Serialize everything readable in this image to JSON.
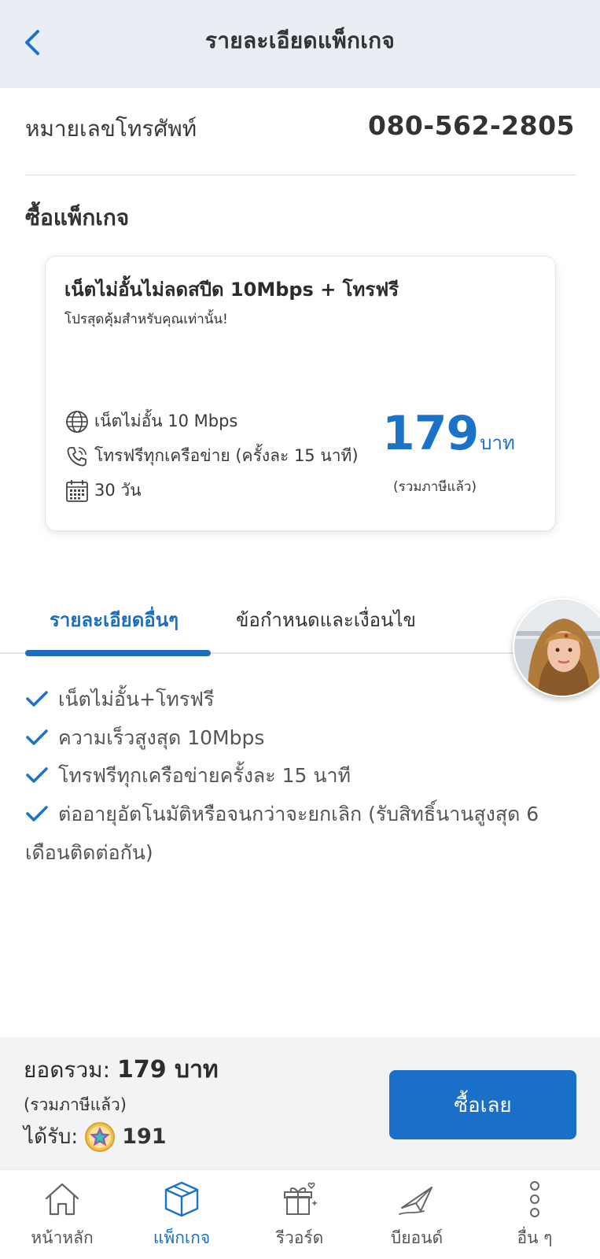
{
  "header": {
    "title": "รายละเอียดแพ็กเกจ",
    "back_icon": "chevron-left-icon"
  },
  "phone": {
    "label": "หมายเลขโทรศัพท์",
    "value": "080-562-2805"
  },
  "section_title": "ซื้อแพ็กเกจ",
  "package": {
    "name": "เน็ตไม่อั้นไม่ลดสปีด 10Mbps + โทรฟรี",
    "subtitle": "โปรสุดคุ้มสำหรับคุณเท่านั้น!",
    "features": [
      {
        "icon": "globe-icon",
        "text": "เน็ตไม่อั้น 10 Mbps"
      },
      {
        "icon": "phone-call-icon",
        "text": "โทรฟรีทุกเครือข่าย (ครั้งละ 15 นาที)"
      },
      {
        "icon": "calendar-icon",
        "text": "30 วัน"
      }
    ],
    "price": "179",
    "price_unit": "บาท",
    "price_note": "(รวมภาษีแล้ว)",
    "accent_color": "#1a73c9"
  },
  "tabs": [
    {
      "label": "รายละเอียดอื่นๆ",
      "active": true
    },
    {
      "label": "ข้อกำหนดและเงื่อนไข",
      "active": false
    }
  ],
  "details": [
    "เน็ตไม่อั้น+โทรฟรี",
    "ความเร็วสูงสุด 10Mbps",
    "โทรฟรีทุกเครือข่ายครั้งละ 15 นาที",
    "ต่ออายุอัตโนมัติหรือจนกว่าจะยกเลิก (รับสิทธิ์นานสูงสุด 6 เดือนติดต่อกัน)"
  ],
  "summary": {
    "total_label": "ยอดรวม:",
    "total_value": "179 บาท",
    "total_note": "(รวมภาษีแล้ว)",
    "points_label": "ได้รับ:",
    "points_value": "191",
    "buy_label": "ซื้อเลย"
  },
  "nav": [
    {
      "icon": "home-icon",
      "label": "หน้าหลัก",
      "active": false
    },
    {
      "icon": "package-box-icon",
      "label": "แพ็กเกจ",
      "active": true
    },
    {
      "icon": "gift-icon",
      "label": "รีวอร์ด",
      "active": false
    },
    {
      "icon": "beyond-plane-icon",
      "label": "บียอนด์",
      "active": false
    },
    {
      "icon": "more-vertical-icon",
      "label": "อื่น ๆ",
      "active": false
    }
  ]
}
